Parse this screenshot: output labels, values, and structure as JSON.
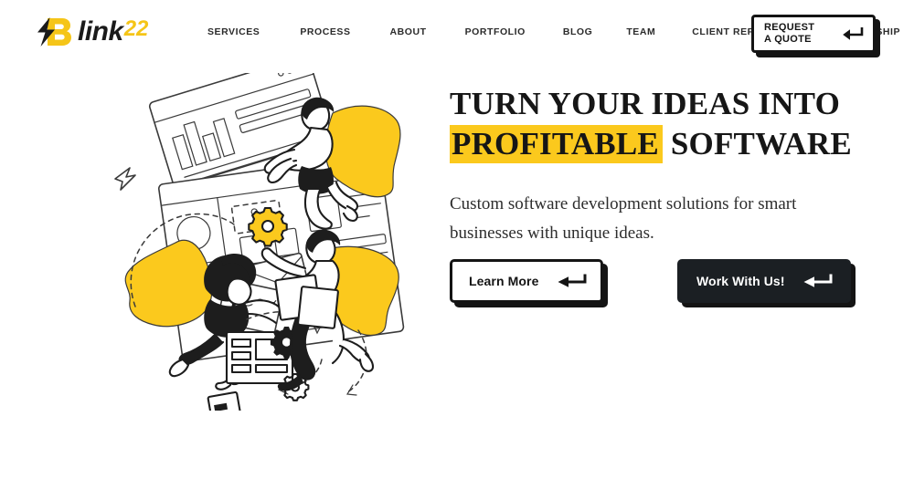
{
  "page": {
    "background_color": "#ffffff",
    "accent_yellow": "#fbc91d",
    "ink_black": "#141414"
  },
  "header": {
    "logo": {
      "name": "Blink22",
      "word_dark": "link",
      "word_number": "22",
      "bolt_icon": "lightning-bolt-icon",
      "colors": {
        "bolt": "#1a1a1a",
        "b_letter": "#f5c518",
        "word": "#1a1a1a",
        "number": "#f5c518"
      }
    },
    "nav": [
      {
        "label": "SERVICES"
      },
      {
        "label": "PROCESS"
      },
      {
        "label": "ABOUT"
      },
      {
        "label": "PORTFOLIO"
      },
      {
        "label": "BLOG"
      },
      {
        "label": "TEAM"
      },
      {
        "label": "CLIENT REFERRAL"
      },
      {
        "label": "PARTNERSHIP"
      }
    ],
    "quote_button": {
      "label": "REQUEST\nA QUOTE",
      "icon": "return-arrow-icon"
    }
  },
  "hero": {
    "title_line1": "TURN YOUR IDEAS INTO",
    "title_highlight": "PROFITABLE",
    "title_after_highlight": "SOFTWARE",
    "subtitle": "Custom software development solutions for smart businesses with unique ideas.",
    "buttons": {
      "learn_more": {
        "label": "Learn More",
        "icon": "return-arrow-icon"
      },
      "work_with_us": {
        "label": "Work With Us!",
        "icon": "return-arrow-icon"
      }
    }
  },
  "illustration": {
    "alt": "Three caped superhero characters assembling dashboards, browser windows and gears",
    "elements": [
      "browser-window-chart",
      "dashboard-window-flowchart",
      "gear-black-large",
      "gear-yellow",
      "gear-black-small",
      "cursor-arrow",
      "hero-male-top",
      "hero-female-left",
      "hero-male-bottom",
      "document-card",
      "mobile-card",
      "dashed-flow-arrows"
    ]
  }
}
